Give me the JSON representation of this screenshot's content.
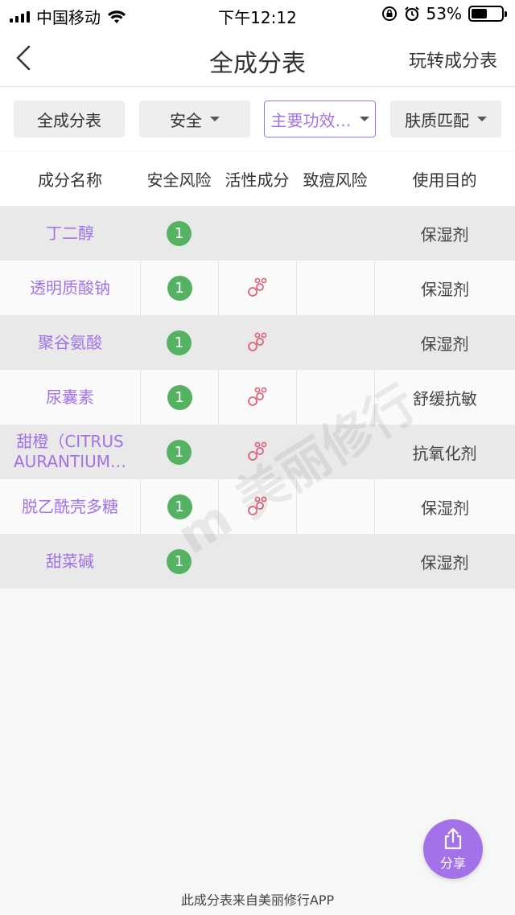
{
  "status_bar": {
    "carrier": "中国移动",
    "time": "下午12:12",
    "battery": "53%",
    "battery_level": 0.53
  },
  "nav": {
    "title": "全成分表",
    "right_label": "玩转成分表"
  },
  "filters": [
    {
      "label": "全成分表",
      "has_caret": false
    },
    {
      "label": "安全",
      "has_caret": true
    },
    {
      "label": "主要功效…",
      "has_caret": true
    },
    {
      "label": "肤质匹配",
      "has_caret": true
    }
  ],
  "table": {
    "headers": [
      "成分名称",
      "安全风险",
      "活性成分",
      "致痘风险",
      "使用目的"
    ],
    "rows": [
      {
        "name": "丁二醇",
        "safety": "1",
        "active": false,
        "acne": "",
        "purpose": "保湿剂"
      },
      {
        "name": "透明质酸钠",
        "safety": "1",
        "active": true,
        "acne": "",
        "purpose": "保湿剂"
      },
      {
        "name": "聚谷氨酸",
        "safety": "1",
        "active": true,
        "acne": "",
        "purpose": "保湿剂"
      },
      {
        "name": "尿囊素",
        "safety": "1",
        "active": true,
        "acne": "",
        "purpose": "舒缓抗敏"
      },
      {
        "name": "甜橙（CITRUS AURANTIUM…",
        "name_line1": "甜橙（CITRUS",
        "name_line2": "AURANTIUM…",
        "safety": "1",
        "active": true,
        "acne": "",
        "purpose": "抗氧化剂"
      },
      {
        "name": "脱乙酰壳多糖",
        "safety": "1",
        "active": true,
        "acne": "",
        "purpose": "保湿剂"
      },
      {
        "name": "甜菜碱",
        "safety": "1",
        "active": false,
        "acne": "",
        "purpose": "保湿剂"
      }
    ]
  },
  "watermark": "美丽修行",
  "share": {
    "label": "分享"
  },
  "footer": "此成分表来自美丽修行APP",
  "colors": {
    "accent": "#a472e8",
    "safety_green": "#56b263",
    "active_icon": "#e0607a"
  }
}
